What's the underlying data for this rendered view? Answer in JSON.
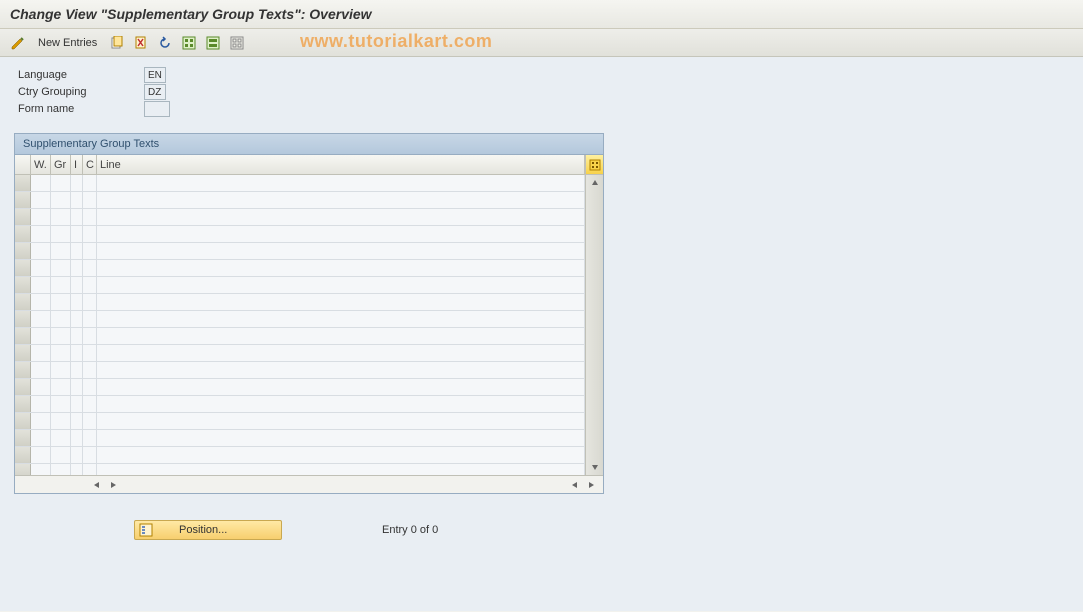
{
  "title": "Change View \"Supplementary Group Texts\": Overview",
  "toolbar": {
    "new_entries": "New Entries"
  },
  "watermark": "www.tutorialkart.com",
  "fields": {
    "language": {
      "label": "Language",
      "value": "EN"
    },
    "ctry_grouping": {
      "label": "Ctry Grouping",
      "value": "DZ"
    },
    "form_name": {
      "label": "Form name",
      "value": ""
    }
  },
  "table": {
    "title": "Supplementary Group Texts",
    "columns": {
      "w": "W.",
      "gr": "Gr",
      "i": "I",
      "c": "C",
      "line": "Line"
    },
    "row_count": 18
  },
  "bottom": {
    "position_label": "Position...",
    "entry_text": "Entry 0 of 0"
  }
}
